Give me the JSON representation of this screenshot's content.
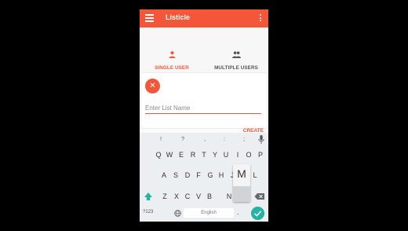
{
  "app": {
    "title": "Listicle"
  },
  "tabs": [
    {
      "label": "SINGLE USER",
      "icon": "person-icon",
      "active": true
    },
    {
      "label": "MULTIPLE USERS",
      "icon": "people-icon",
      "active": false
    }
  ],
  "form": {
    "placeholder": "Enter List Name",
    "value": "",
    "create_label": "CREATE"
  },
  "keyboard": {
    "suggestions": [
      "!",
      "?",
      ",",
      ":",
      ";"
    ],
    "row1": [
      "Q",
      "W",
      "E",
      "R",
      "T",
      "Y",
      "U",
      "I",
      "O",
      "P"
    ],
    "row2": [
      "A",
      "S",
      "D",
      "F",
      "G",
      "H",
      "J",
      "K",
      "L"
    ],
    "row3": [
      "Z",
      "X",
      "C",
      "V",
      "B",
      "N",
      "M"
    ],
    "pressed_key": "M",
    "numbers_label": "?123",
    "space_label": "English",
    "period": "."
  },
  "colors": {
    "accent": "#f4563a",
    "enter": "#25b3a3"
  }
}
